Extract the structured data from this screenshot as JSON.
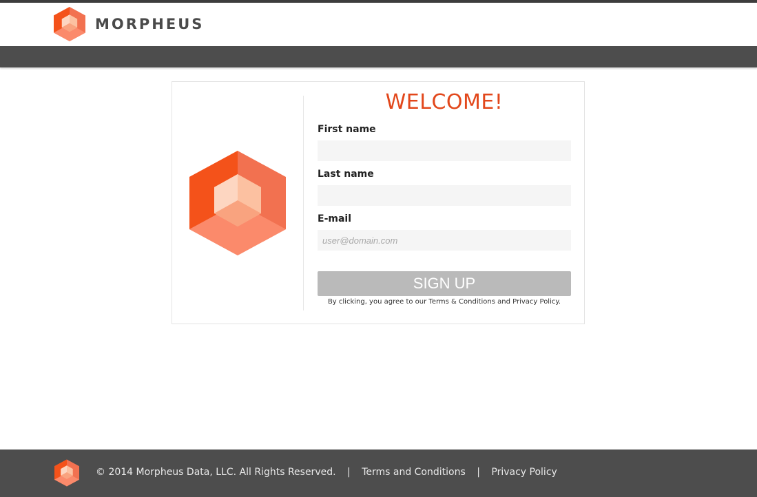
{
  "brand": {
    "name": "MORPHEUS",
    "logo_icon": "morpheus-hexagon-logo",
    "accent": "#e2471b"
  },
  "signup_form": {
    "title": "WELCOME!",
    "first_name": {
      "label": "First name",
      "value": "",
      "placeholder": ""
    },
    "last_name": {
      "label": "Last name",
      "value": "",
      "placeholder": ""
    },
    "email": {
      "label": "E-mail",
      "value": "",
      "placeholder": "user@domain.com"
    },
    "submit_label": "SIGN UP",
    "agreement_text": "By clicking, you agree to our Terms & Conditions and Privacy Policy."
  },
  "footer": {
    "copyright": "© 2014 Morpheus Data, LLC. All Rights Reserved.",
    "separator": "|",
    "terms_link": "Terms and Conditions",
    "privacy_link": "Privacy Policy"
  },
  "colors": {
    "header_bar": "#4d4d4d",
    "button_disabled": "#bababa",
    "input_bg": "#f5f5f5"
  }
}
